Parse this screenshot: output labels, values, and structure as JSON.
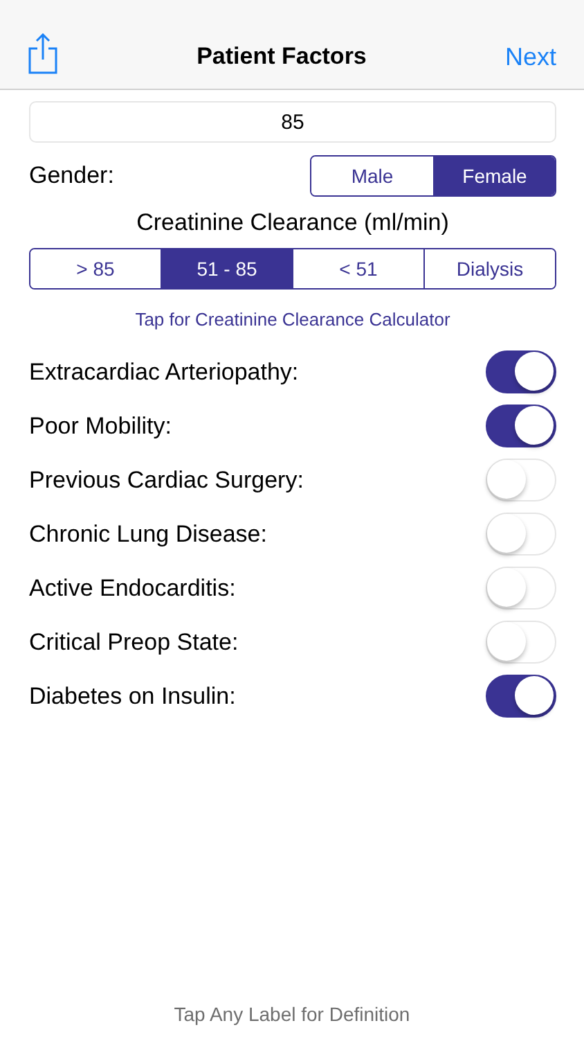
{
  "nav": {
    "title": "Patient Factors",
    "action": "Next"
  },
  "age_field": {
    "value": "85"
  },
  "gender": {
    "label": "Gender:",
    "options": [
      {
        "label": "Male",
        "selected": false
      },
      {
        "label": "Female",
        "selected": true
      }
    ]
  },
  "creatinine": {
    "title": "Creatinine Clearance (ml/min)",
    "options": [
      {
        "label": "> 85",
        "selected": false
      },
      {
        "label": "51 - 85",
        "selected": true
      },
      {
        "label": "< 51",
        "selected": false
      },
      {
        "label": "Dialysis",
        "selected": false
      }
    ],
    "calculator_link": "Tap for Creatinine Clearance Calculator"
  },
  "factors": [
    {
      "label": "Extracardiac Arteriopathy:",
      "on": true
    },
    {
      "label": "Poor Mobility:",
      "on": true
    },
    {
      "label": "Previous Cardiac Surgery:",
      "on": false
    },
    {
      "label": "Chronic Lung Disease:",
      "on": false
    },
    {
      "label": "Active Endocarditis:",
      "on": false
    },
    {
      "label": "Critical Preop State:",
      "on": false
    },
    {
      "label": "Diabetes on Insulin:",
      "on": true
    }
  ],
  "footer": "Tap Any Label for Definition"
}
